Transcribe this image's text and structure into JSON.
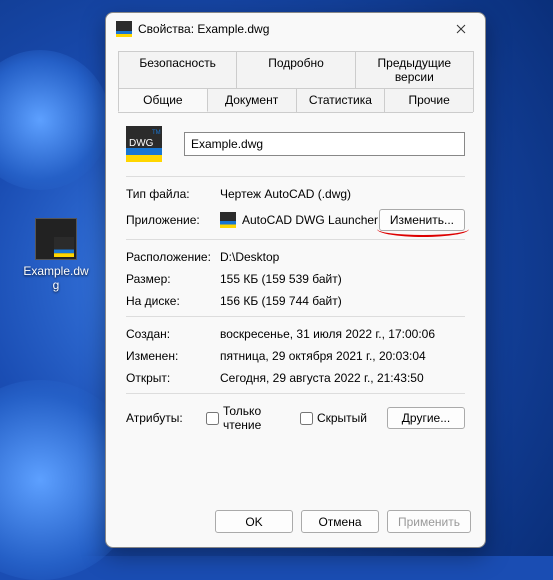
{
  "desktop": {
    "icon_label": "Example.dwg"
  },
  "dialog": {
    "title": "Свойства: Example.dwg",
    "tabs_row1": [
      "Безопасность",
      "Подробно",
      "Предыдущие версии"
    ],
    "tabs_row2": [
      "Общие",
      "Документ",
      "Статистика",
      "Прочие"
    ],
    "active_tab": "Общие",
    "filename": "Example.dwg",
    "label_filetype": "Тип файла:",
    "value_filetype": "Чертеж AutoCAD (.dwg)",
    "label_app": "Приложение:",
    "value_app": "AutoCAD DWG Launcher",
    "btn_change": "Изменить...",
    "label_location": "Расположение:",
    "value_location": "D:\\Desktop",
    "label_size": "Размер:",
    "value_size": "155 КБ (159 539 байт)",
    "label_ondisk": "На диске:",
    "value_ondisk": "156 КБ (159 744 байт)",
    "label_created": "Создан:",
    "value_created": "воскресенье, 31 июля 2022 г., 17:00:06",
    "label_modified": "Изменен:",
    "value_modified": "пятница, 29 октября 2021 г., 20:03:04",
    "label_accessed": "Открыт:",
    "value_accessed": "Сегодня, 29 августа 2022 г., 21:43:50",
    "label_attrs": "Атрибуты:",
    "chk_readonly": "Только чтение",
    "chk_hidden": "Скрытый",
    "btn_other": "Другие...",
    "btn_ok": "OK",
    "btn_cancel": "Отмена",
    "btn_apply": "Применить"
  }
}
